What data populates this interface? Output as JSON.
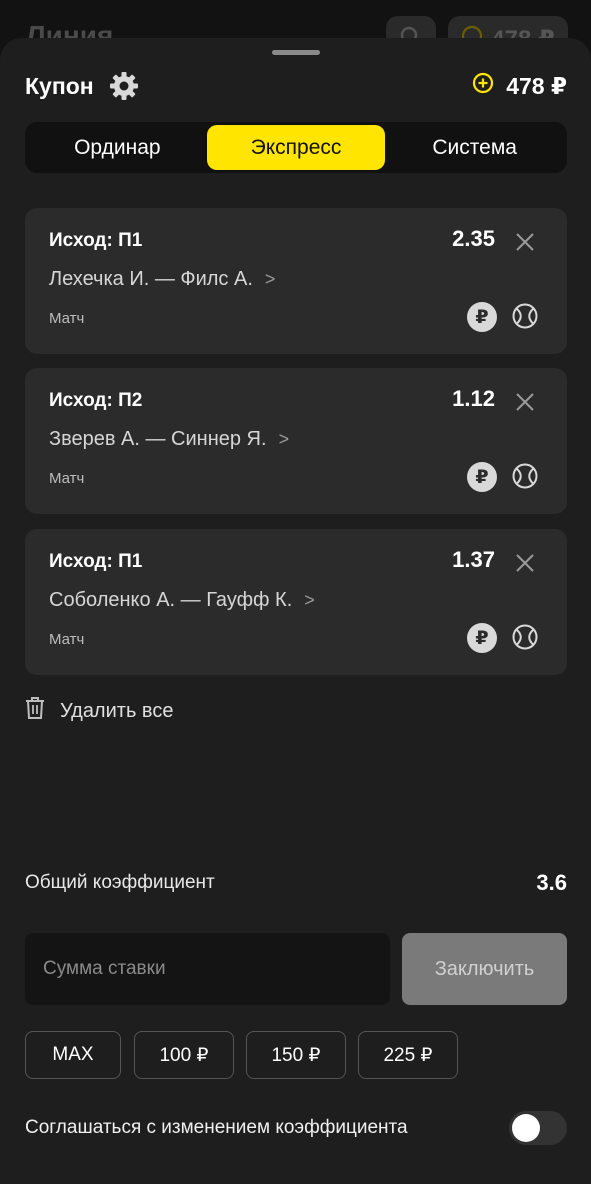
{
  "background": {
    "title": "Линия",
    "balance": "478 ₽"
  },
  "header": {
    "title": "Купон",
    "balance": "478 ₽"
  },
  "tabs": [
    {
      "label": "Ординар",
      "active": false
    },
    {
      "label": "Экспресс",
      "active": true
    },
    {
      "label": "Система",
      "active": false
    }
  ],
  "bets": [
    {
      "outcome": "Исход: П1",
      "odds": "2.35",
      "match": "Лехечка И. — Филс А.",
      "type": "Матч"
    },
    {
      "outcome": "Исход: П2",
      "odds": "1.12",
      "match": "Зверев А. — Синнер Я.",
      "type": "Матч"
    },
    {
      "outcome": "Исход: П1",
      "odds": "1.37",
      "match": "Соболенко А. — Гауфф К.",
      "type": "Матч"
    }
  ],
  "delete_all": "Удалить все",
  "total": {
    "label": "Общий коэффициент",
    "value": "3.6"
  },
  "stake": {
    "placeholder": "Сумма ставки",
    "submit": "Заключить"
  },
  "quick_amounts": [
    "MAX",
    "100 ₽",
    "150 ₽",
    "225 ₽"
  ],
  "agree": {
    "label": "Соглашаться с изменением коэффициента",
    "enabled": false
  },
  "colors": {
    "accent": "#ffe500",
    "sheet": "#1e1e1e",
    "card": "#2b2b2b"
  }
}
